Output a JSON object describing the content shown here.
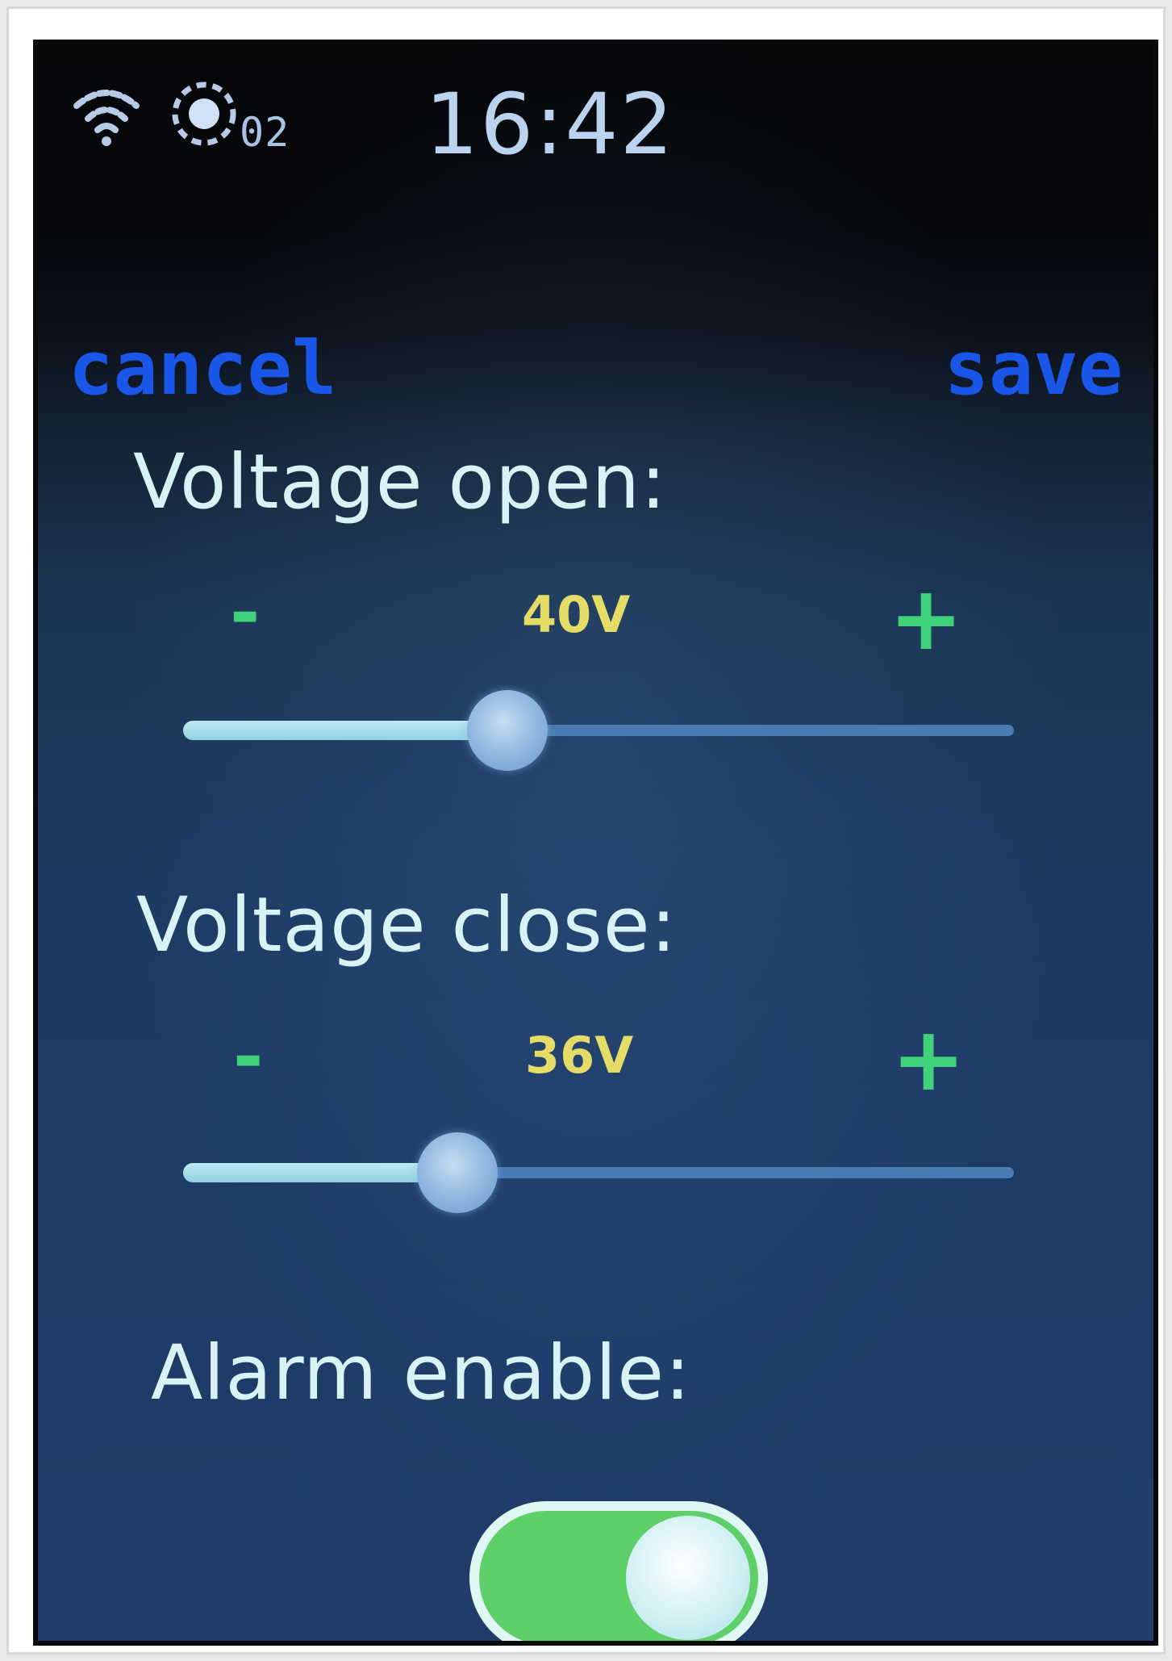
{
  "status_bar": {
    "wifi_icon": "wifi-icon",
    "gps_icon": "gps-icon",
    "satellite_count": "02",
    "time": "16:42"
  },
  "nav": {
    "cancel_label": "cancel",
    "save_label": "save"
  },
  "voltage_open": {
    "label": "Voltage open:",
    "minus": "-",
    "plus": "+",
    "value": "40V",
    "slider_fraction": 0.39
  },
  "voltage_close": {
    "label": "Voltage close:",
    "minus": "-",
    "plus": "+",
    "value": "36V",
    "slider_fraction": 0.33
  },
  "alarm": {
    "label": "Alarm enable:",
    "enabled": true
  },
  "colors": {
    "nav_accent": "#1a56e8",
    "stepper": "#3fd27a",
    "value": "#e4dc66",
    "label": "#d8f3f6",
    "toggle_on": "#5fcf6a"
  }
}
